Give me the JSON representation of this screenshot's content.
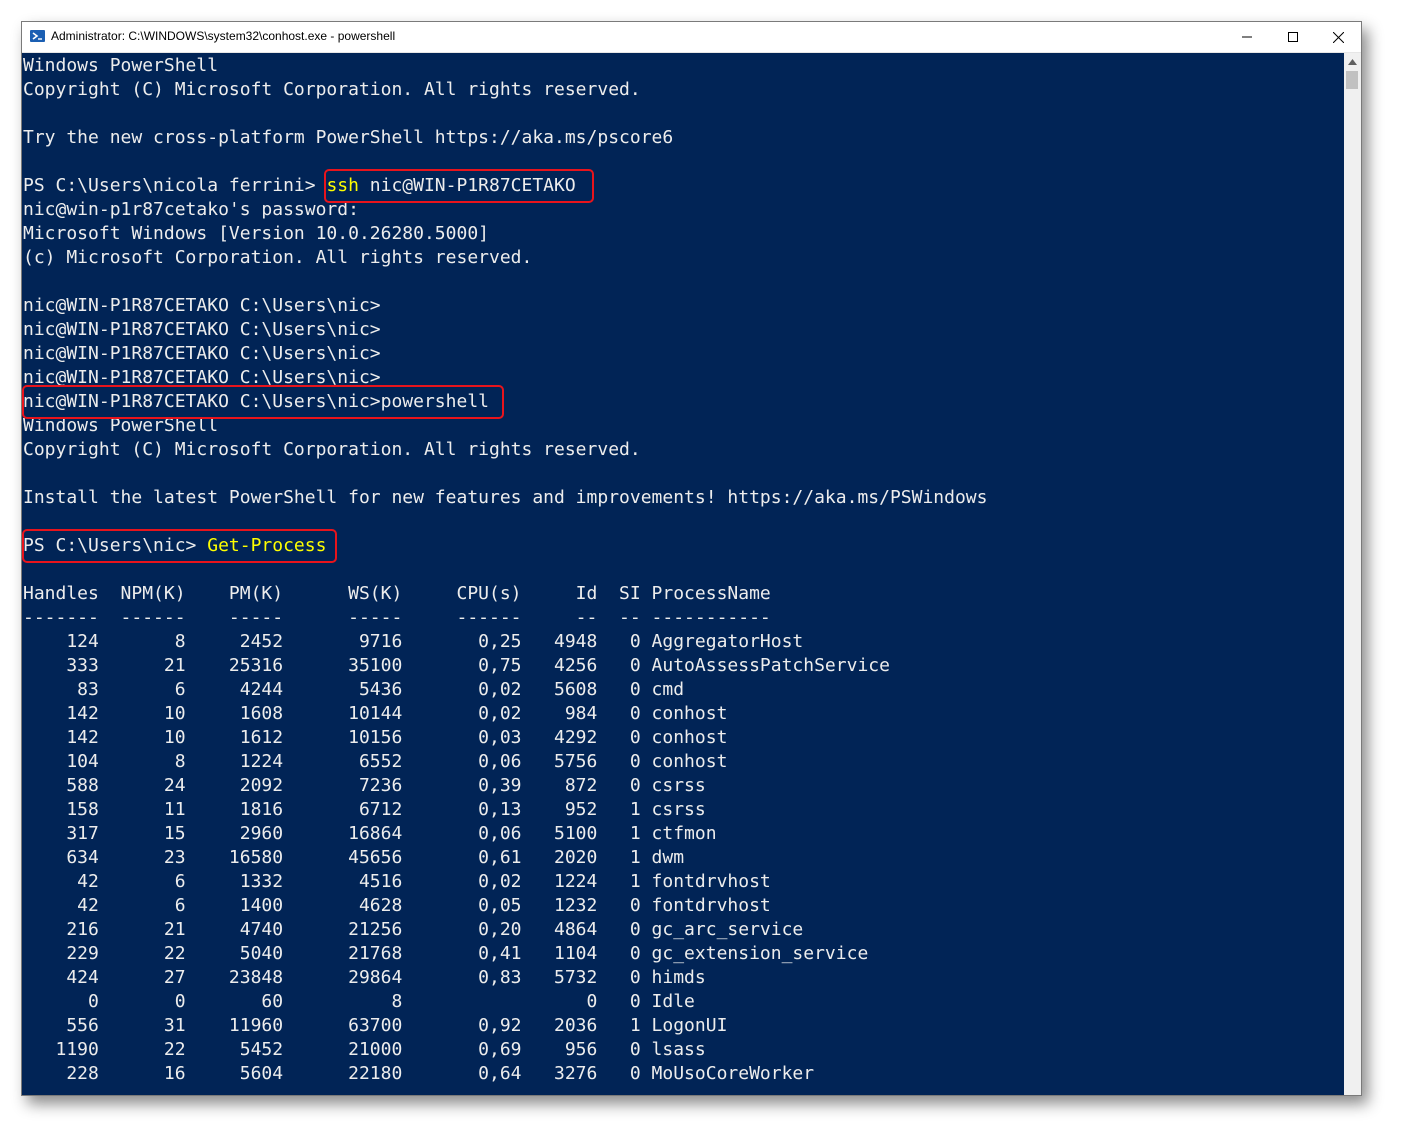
{
  "window": {
    "title": "Administrator: C:\\WINDOWS\\system32\\conhost.exe - powershell",
    "minimize_label": "−",
    "maximize_label": "☐",
    "close_label": "✕",
    "icon": "powershell-icon"
  },
  "colors": {
    "console_bg": "#012456",
    "console_text": "#ededed",
    "command_text": "#fefe00",
    "highlight_border": "#e8141c"
  },
  "console": {
    "l01": "Windows PowerShell",
    "l02": "Copyright (C) Microsoft Corporation. All rights reserved.",
    "l04": "Try the new cross-platform PowerShell https://aka.ms/pscore6",
    "l06_prompt": "PS C:\\Users\\nicola ferrini> ",
    "l06_cmd": "ssh",
    "l06_arg": " nic@WIN-P1R87CETAKO",
    "l07": "nic@win-p1r87cetako's password:",
    "l08": "Microsoft Windows [Version 10.0.26280.5000]",
    "l09": "(c) Microsoft Corporation. All rights reserved.",
    "l11": "nic@WIN-P1R87CETAKO C:\\Users\\nic>",
    "l12": "nic@WIN-P1R87CETAKO C:\\Users\\nic>",
    "l13": "nic@WIN-P1R87CETAKO C:\\Users\\nic>",
    "l14": "nic@WIN-P1R87CETAKO C:\\Users\\nic>",
    "l15": "nic@WIN-P1R87CETAKO C:\\Users\\nic>powershell",
    "l16": "Windows PowerShell",
    "l17": "Copyright (C) Microsoft Corporation. All rights reserved.",
    "l19": "Install the latest PowerShell for new features and improvements! https://aka.ms/PSWindows",
    "l21_prompt": "PS C:\\Users\\nic> ",
    "l21_cmd": "Get-Process",
    "header": "Handles  NPM(K)    PM(K)      WS(K)     CPU(s)     Id  SI ProcessName",
    "dashes": "-------  ------    -----      -----     ------     --  -- -----------"
  },
  "process_table": {
    "columns": [
      "Handles",
      "NPM(K)",
      "PM(K)",
      "WS(K)",
      "CPU(s)",
      "Id",
      "SI",
      "ProcessName"
    ],
    "rows": [
      [
        "124",
        "8",
        "2452",
        "9716",
        "0,25",
        "4948",
        "0",
        "AggregatorHost"
      ],
      [
        "333",
        "21",
        "25316",
        "35100",
        "0,75",
        "4256",
        "0",
        "AutoAssessPatchService"
      ],
      [
        "83",
        "6",
        "4244",
        "5436",
        "0,02",
        "5608",
        "0",
        "cmd"
      ],
      [
        "142",
        "10",
        "1608",
        "10144",
        "0,02",
        "984",
        "0",
        "conhost"
      ],
      [
        "142",
        "10",
        "1612",
        "10156",
        "0,03",
        "4292",
        "0",
        "conhost"
      ],
      [
        "104",
        "8",
        "1224",
        "6552",
        "0,06",
        "5756",
        "0",
        "conhost"
      ],
      [
        "588",
        "24",
        "2092",
        "7236",
        "0,39",
        "872",
        "0",
        "csrss"
      ],
      [
        "158",
        "11",
        "1816",
        "6712",
        "0,13",
        "952",
        "1",
        "csrss"
      ],
      [
        "317",
        "15",
        "2960",
        "16864",
        "0,06",
        "5100",
        "1",
        "ctfmon"
      ],
      [
        "634",
        "23",
        "16580",
        "45656",
        "0,61",
        "2020",
        "1",
        "dwm"
      ],
      [
        "42",
        "6",
        "1332",
        "4516",
        "0,02",
        "1224",
        "1",
        "fontdrvhost"
      ],
      [
        "42",
        "6",
        "1400",
        "4628",
        "0,05",
        "1232",
        "0",
        "fontdrvhost"
      ],
      [
        "216",
        "21",
        "4740",
        "21256",
        "0,20",
        "4864",
        "0",
        "gc_arc_service"
      ],
      [
        "229",
        "22",
        "5040",
        "21768",
        "0,41",
        "1104",
        "0",
        "gc_extension_service"
      ],
      [
        "424",
        "27",
        "23848",
        "29864",
        "0,83",
        "5732",
        "0",
        "himds"
      ],
      [
        "0",
        "0",
        "60",
        "8",
        "",
        "0",
        "0",
        "Idle"
      ],
      [
        "556",
        "31",
        "11960",
        "63700",
        "0,92",
        "2036",
        "1",
        "LogonUI"
      ],
      [
        "1190",
        "22",
        "5452",
        "21000",
        "0,69",
        "956",
        "0",
        "lsass"
      ],
      [
        "228",
        "16",
        "5604",
        "22180",
        "0,64",
        "3276",
        "0",
        "MoUsoCoreWorker"
      ]
    ]
  }
}
